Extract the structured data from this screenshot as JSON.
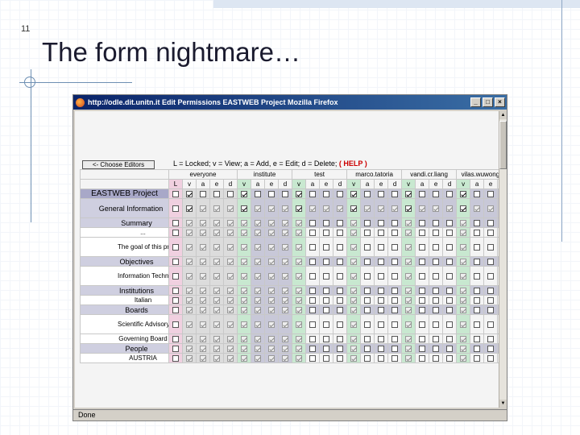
{
  "slide": {
    "number": "11",
    "title": "The form nightmare…"
  },
  "browser": {
    "window_title": "http://odle.dit.unitn.it  Edit Permissions  EASTWEB Project  Mozilla Firefox",
    "status": "Done"
  },
  "form": {
    "choose_editors_label": "<- Choose Editors",
    "legend_text": "L = Locked; v = View; a = Add, e = Edit; d = Delete;",
    "help_label": "( HELP )",
    "users": [
      "everyone",
      "institute",
      "test",
      "marco.tatoria",
      "vandi.cr.liang",
      "vilas.wuwongse"
    ],
    "perm_header_first": [
      "L",
      "v",
      "a",
      "e",
      "d"
    ],
    "perm_header": [
      "v",
      "a",
      "e",
      "d"
    ],
    "rows": [
      {
        "label": "EASTWEB Project",
        "level": 0,
        "section": true
      },
      {
        "label": "General Information",
        "level": 1,
        "section": true
      },
      {
        "label": "Summary",
        "level": 2,
        "section": true
      },
      {
        "label": "...",
        "level": 3,
        "section": false
      },
      {
        "label": "The goal of this project ...",
        "level": 3,
        "section": false
      },
      {
        "label": "Objectives",
        "level": 2,
        "section": true
      },
      {
        "label": "Information Technology (...",
        "level": 3,
        "section": false
      },
      {
        "label": "Institutions",
        "level": 2,
        "section": true
      },
      {
        "label": "Italian",
        "level": 3,
        "section": false
      },
      {
        "label": "Boards",
        "level": 2,
        "section": true
      },
      {
        "label": "Scientific Advisory Board",
        "level": 3,
        "section": false
      },
      {
        "label": "Governing Board",
        "level": 3,
        "section": false
      },
      {
        "label": "People",
        "level": 2,
        "section": true
      },
      {
        "label": "AUSTRIA",
        "level": 3,
        "section": false
      }
    ]
  },
  "colors": {
    "everyone_bg": "#dcdcdc",
    "institute_bg": "#e8c8d8",
    "view_bg": "#c8e8d0",
    "locked_bg": "#f0d0e0",
    "gray_bg": "#c8c8d8"
  }
}
